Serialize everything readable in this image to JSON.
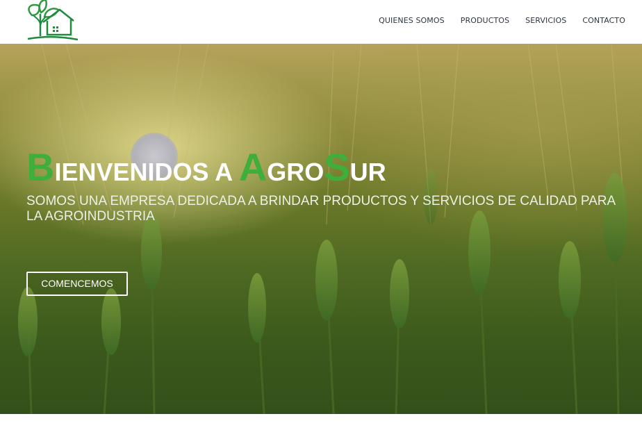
{
  "header": {
    "logo_icon": "agrosur-leaf-house-logo",
    "nav": [
      {
        "label": "QUIENES SOMOS"
      },
      {
        "label": "PRODUCTOS"
      },
      {
        "label": "SERVICIOS"
      },
      {
        "label": "CONTACTO"
      }
    ]
  },
  "hero": {
    "title": {
      "part1_initial": "B",
      "part1_rest": "IENVENIDOS A ",
      "part2_initial": "A",
      "part2_rest": "GRO",
      "part3_initial": "S",
      "part3_rest": "UR"
    },
    "subtitle": "SOMOS UNA EMPRESA DEDICADA A BRINDAR PRODUCTOS Y SERVICIOS DE CALIDAD PARA LA AGROINDUSTRIA",
    "cta_label": "COMENCEMOS"
  },
  "colors": {
    "brand_green": "#3fae3b",
    "logo_green": "#1f8a3c",
    "nav_text": "#2c3540"
  }
}
